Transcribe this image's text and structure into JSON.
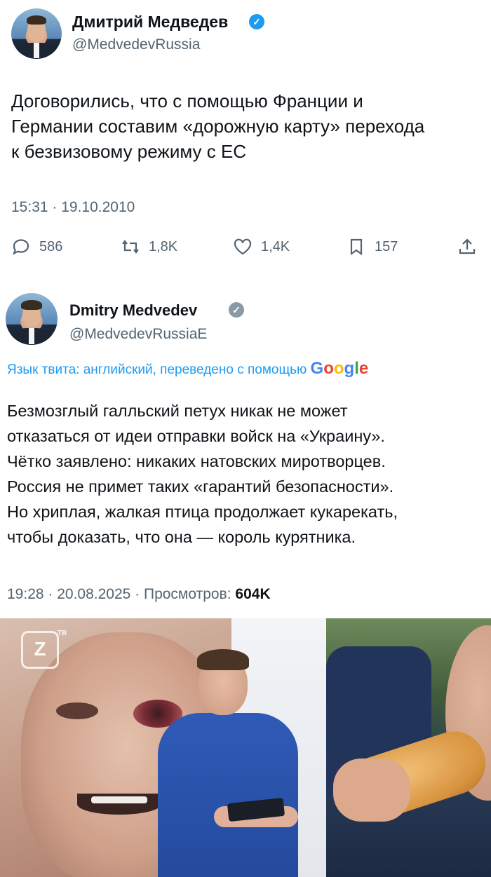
{
  "tweet1": {
    "name": "Дмитрий Медведев",
    "handle": "@MedvedevRussia",
    "text_lines": [
      "Договорились, что с помощью Франции и",
      "Германии составим «дорожную карту» перехода",
      "к безвизовому режиму с ЕС"
    ],
    "timestamp": "15:31 · 19.10.2010",
    "actions": {
      "replies": "586",
      "retweets": "1,8K",
      "likes": "1,4K",
      "bookmarks": "157"
    }
  },
  "tweet2": {
    "name": "Dmitry Medvedev",
    "handle": "@MedvedevRussiaE",
    "translation_note": "Язык твита: английский, переведено с помощью",
    "translation_brand": "Google",
    "text_lines": [
      "Безмозглый галльский петух никак не может",
      "отказаться от идеи отправки войск на «Украину».",
      "Чётко заявлено: никаких натовских миротворцев.",
      "Россия не примет таких «гарантий безопасности».",
      "Но хриплая, жалкая птица продолжает кукарекать,",
      "чтобы доказать, что она — король курятника."
    ],
    "timestamp": "19:28 · 20.08.2025 · Просмотров:",
    "views": "604K"
  },
  "photo": {
    "watermark": "ТВ"
  },
  "colors": {
    "text": "#0f1419",
    "secondary": "#536471",
    "accent": "#1d9bf0"
  }
}
